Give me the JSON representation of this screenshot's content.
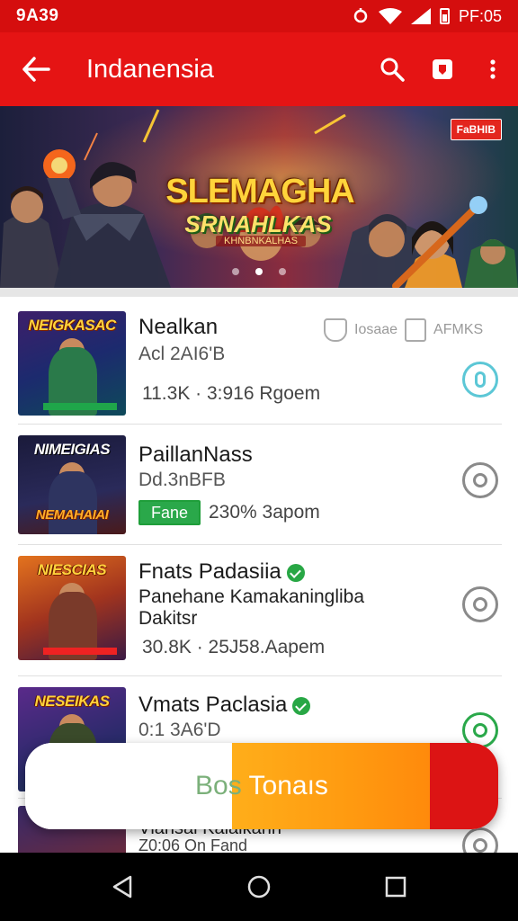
{
  "status_bar": {
    "time": "9A39",
    "right_text": "PF:05"
  },
  "app_bar": {
    "title": "Indanensia"
  },
  "banner": {
    "logo_line1": "SLEMAGHA",
    "logo_line2": "SRNAHLKAS",
    "logo_line3": "KHNBNKALHAS",
    "badge": "FaBHIB"
  },
  "small_icons": {
    "label1": "Iosaae",
    "label2": "AFMKS"
  },
  "list": [
    {
      "thumb_title": "NEIGKASAC",
      "title": "Nealkan",
      "sub": "Acl 2AI6'B",
      "meta": "11.3K · 3:916 Rgoem"
    },
    {
      "thumb_title": "NIMEIGIAS",
      "thumb_caption": "NEMAHAIAI",
      "title": "PaillanNass",
      "sub": "Dd.3nBFB",
      "button": "Fane",
      "meta": "230% 3apom"
    },
    {
      "thumb_title": "NIESCIAS",
      "title": "Fnats Padasiia",
      "desc_line1": "Panehane Kamakaningliba",
      "desc_line2": "Dakitsr",
      "meta": "30.8K · 25J58.Aapem"
    },
    {
      "thumb_title": "NESEIKAS",
      "title": "Vmats Paclasia",
      "sub": "0:1 3A6'D"
    },
    {
      "title": "Vlansai Kalaikann",
      "meta": "Z0:06 On Fand"
    }
  ],
  "fab": {
    "label_part1": "Bos",
    "label_part2": " Tonaıs"
  },
  "colors": {
    "brand_red": "#e51414",
    "accent_orange": "#ff9a10",
    "verified_green": "#28a745"
  }
}
